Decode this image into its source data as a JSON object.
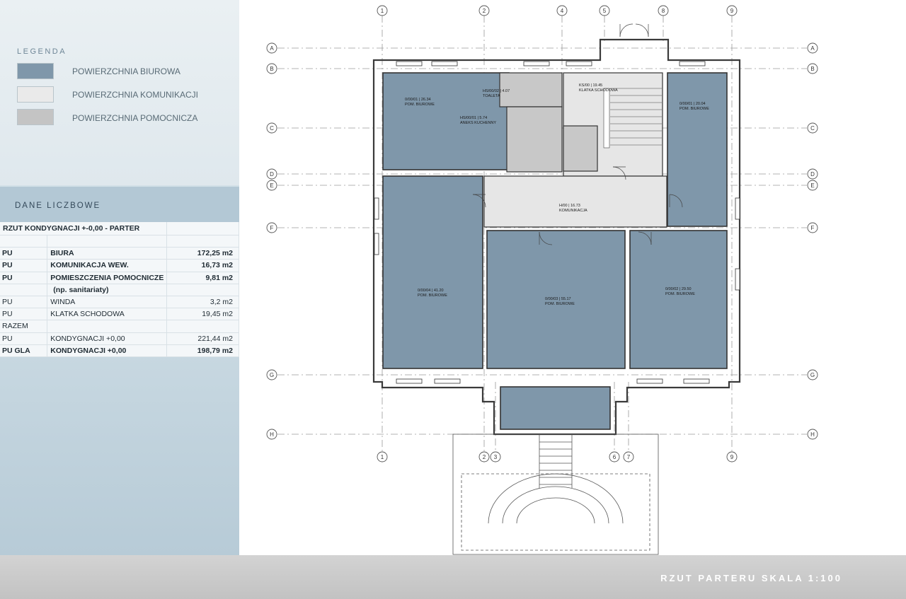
{
  "legend": {
    "title": "LEGENDA",
    "items": [
      {
        "label": "POWIERZCHNIA BIUROWA",
        "color": "#7f97aa"
      },
      {
        "label": "POWIERZCHNIA KOMUNIKACJI",
        "color": "#eaeaea"
      },
      {
        "label": "POWIERZCHNIA POMOCNICZA",
        "color": "#c4c4c4"
      }
    ]
  },
  "data_panel": {
    "title": "DANE LICZBOWE",
    "header": "RZUT KONDYGNACJI +-0,00 - PARTER",
    "rows": [
      {
        "code": "",
        "label": "",
        "value": "",
        "bold": false
      },
      {
        "code": "PU",
        "label": "BIURA",
        "value": "172,25 m2",
        "bold": true
      },
      {
        "code": "PU",
        "label": "KOMUNIKACJA WEW.",
        "value": "16,73 m2",
        "bold": true
      },
      {
        "code": "PU",
        "label": "POMIESZCZENIA POMOCNICZE",
        "value": "9,81 m2",
        "bold": true
      },
      {
        "code": "",
        "label": "(np. sanitariaty)",
        "value": "",
        "bold": true
      },
      {
        "code": "PU",
        "label": "WINDA",
        "value": "3,2 m2",
        "bold": false
      },
      {
        "code": "PU",
        "label": "KLATKA SCHODOWA",
        "value": "19,45 m2",
        "bold": false
      },
      {
        "code": "RAZEM",
        "label": "",
        "value": "",
        "bold": false
      },
      {
        "code": "PU",
        "label": "KONDYGNACJI +0,00",
        "value": "221,44 m2",
        "bold": false
      },
      {
        "code": "PU  GLA",
        "label": "KONDYGNACJI +0,00",
        "value": "198,79 m2",
        "bold": true
      }
    ]
  },
  "plan": {
    "caption": "RZUT PARTERU SKALA 1:100",
    "grid_columns": [
      "1",
      "2",
      "4",
      "5",
      "8",
      "9"
    ],
    "grid_columns_bottom": [
      "1",
      "2",
      "3",
      "6",
      "7",
      "9"
    ],
    "grid_rows": [
      "A",
      "B",
      "C",
      "D",
      "E",
      "F",
      "G",
      "H"
    ],
    "rooms": [
      {
        "code": "0/00/01",
        "area": "26.34",
        "name": "POM. BIUROWE"
      },
      {
        "code": "HS/00/02",
        "area": "4.07",
        "name": "TOALETA"
      },
      {
        "code": "HS/00/01",
        "area": "5.74",
        "name": "ANEKS KUCHENNY"
      },
      {
        "code": "KS/00",
        "area": "19.45",
        "name": "KLATKA SCHODOWA"
      },
      {
        "code": "0/00/01",
        "area": "20.04",
        "name": "POM. BIUROWE"
      },
      {
        "code": "H/00",
        "area": "16.73",
        "name": "KOMUNIKACJA"
      },
      {
        "code": "0/00/04",
        "area": "41.20",
        "name": "POM. BIUROWE"
      },
      {
        "code": "0/00/03",
        "area": "55.17",
        "name": "POM. BIUROWE"
      },
      {
        "code": "0/00/02",
        "area": "29.50",
        "name": "POM. BIUROWE"
      }
    ]
  }
}
